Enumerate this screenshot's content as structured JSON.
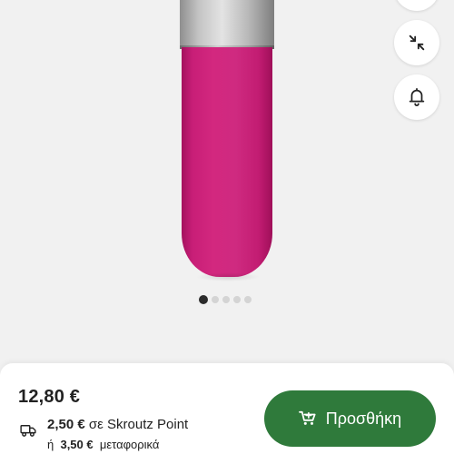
{
  "gallery": {
    "product_colors": {
      "cap": "#c4c4c4",
      "body": "#cf2a80"
    },
    "pager": {
      "count": 5,
      "active_index": 0
    }
  },
  "actions": {
    "icons": [
      "more-icon",
      "collapse-icon",
      "bell-icon"
    ]
  },
  "purchase": {
    "price": "12,80 €",
    "shipping_point_price": "2,50 €",
    "shipping_point_text": "σε Skroutz Point",
    "shipping_alt_prefix": "ή",
    "shipping_alt_price": "3,50 €",
    "shipping_alt_text": "μεταφορικά",
    "add_button_label": "Προσθήκη",
    "accent_color": "#2f7a3b"
  }
}
